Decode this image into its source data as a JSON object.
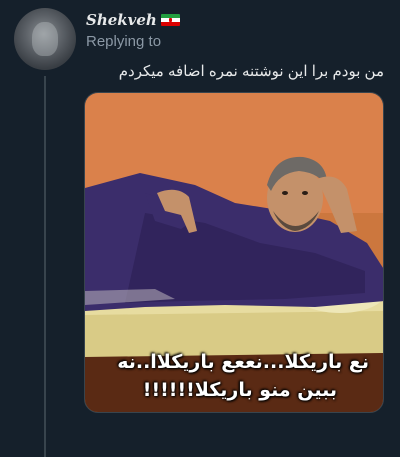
{
  "reply": {
    "username": "Shekveh",
    "flag_icon": "iran-flag-icon",
    "replying_label": "Replying to",
    "text": "من بودم برا این نوشتنه نمره اضافه میکردم"
  },
  "media": {
    "caption_line1": "نع باریکلا...نععع باریکلاا..نه",
    "caption_line2": "ببین منو باریکلا!!!!!!",
    "colors": {
      "wall": "#d67a45",
      "robe": "#3b2d6b",
      "bed": "#e7dca0",
      "frame": "#5a2a14"
    }
  }
}
